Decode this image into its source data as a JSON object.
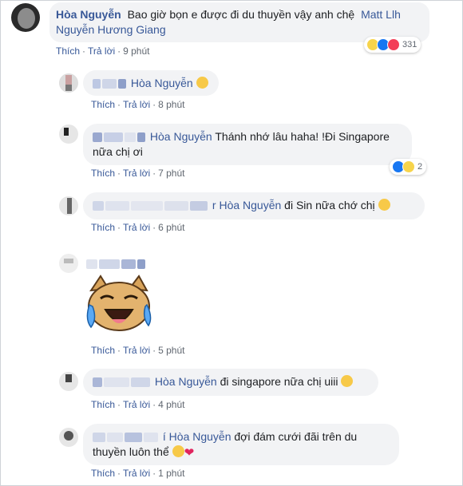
{
  "comments": [
    {
      "name": "Hòa Nguyễn",
      "text": "Bao giờ bọn e được đi du thuyền vậy anh chệ",
      "mentions": [
        "Matt Llh",
        "Nguyễn Hương Giang"
      ],
      "reactions": {
        "icons": [
          "haha-icon",
          "like-icon",
          "love-icon"
        ],
        "count": "331"
      },
      "actions": {
        "like": "Thích",
        "reply": "Trả lời",
        "time": "9 phút"
      }
    }
  ],
  "replies": [
    {
      "mention": "Hòa Nguyễn",
      "text": "",
      "actions": {
        "like": "Thích",
        "reply": "Trả lời",
        "time": "8 phút"
      }
    },
    {
      "mention": "Hòa Nguyễn",
      "text_line1": "Thánh nhớ lâu haha! !Đi Singapore",
      "text_line2": "nữa chị ơi",
      "reactions": {
        "icons": [
          "like-icon",
          "haha-icon"
        ],
        "count": "2"
      },
      "actions": {
        "like": "Thích",
        "reply": "Trả lời",
        "time": "7 phút"
      }
    },
    {
      "prefix": "r",
      "mention": "Hòa Nguyễn",
      "text": "đi Sin nữa chớ chị",
      "actions": {
        "like": "Thích",
        "reply": "Trả lời",
        "time": "6 phút"
      }
    },
    {
      "sticker": "laughing-cat-sticker",
      "actions": {
        "like": "Thích",
        "reply": "Trả lời",
        "time": "5 phút"
      }
    },
    {
      "mention": "Hòa Nguyễn",
      "text": "đi singapore nữa chị uiii",
      "actions": {
        "like": "Thích",
        "reply": "Trả lời",
        "time": "4 phút"
      }
    },
    {
      "prefix": "í",
      "mention": "Hòa Nguyễn",
      "text_line1": "đợi đám cưới đãi trên du",
      "text_line2": "thuyền luôn thể",
      "actions": {
        "like": "Thích",
        "reply": "Trả lời",
        "time": "1 phút"
      }
    }
  ],
  "colors": {
    "link": "#385898",
    "bubble": "#f2f3f5",
    "meta": "#606770"
  }
}
